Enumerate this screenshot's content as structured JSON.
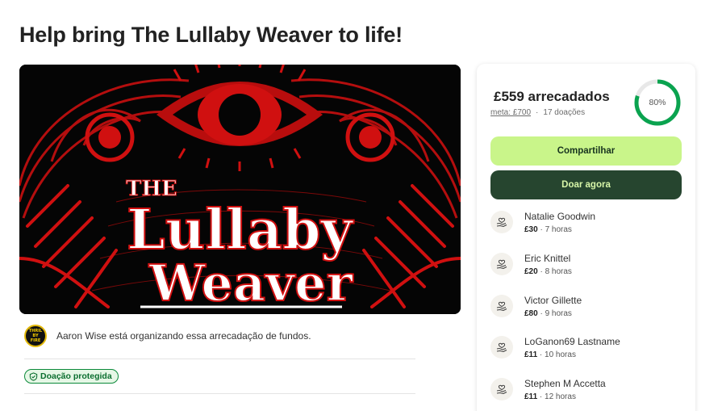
{
  "page": {
    "title": "Help bring The Lullaby Weaver to life!"
  },
  "hero": {
    "line1": "THE",
    "line2": "Lullaby",
    "line3": "Weaver",
    "colors": {
      "red": "#d01010",
      "white": "#ffffff",
      "bg": "#050505"
    }
  },
  "organizer": {
    "text": "Aaron Wise está organizando essa arrecadação de fundos.",
    "avatar_line1": "THRIL",
    "avatar_line2": "BY",
    "avatar_line3": "FIRE"
  },
  "badge": {
    "label": "Doação protegida"
  },
  "summary": {
    "raised": "£559 arrecadados",
    "goal": "meta: £700",
    "separator": "·",
    "donations": "17 doações",
    "progress_label": "80%",
    "progress_fraction": 0.8,
    "progress_color": "#0aa34f"
  },
  "buttons": {
    "share": "Compartilhar",
    "donate": "Doar agora"
  },
  "donors": [
    {
      "name": "Natalie Goodwin",
      "amount": "£30",
      "time": " · 7 horas"
    },
    {
      "name": "Eric Knittel",
      "amount": "£20",
      "time": " · 8 horas"
    },
    {
      "name": "Victor Gillette",
      "amount": "£80",
      "time": " · 9 horas"
    },
    {
      "name": "LoGanon69 Lastname",
      "amount": "£11",
      "time": " · 10 horas"
    },
    {
      "name": "Stephen M Accetta",
      "amount": "£11",
      "time": " · 12 horas"
    }
  ]
}
